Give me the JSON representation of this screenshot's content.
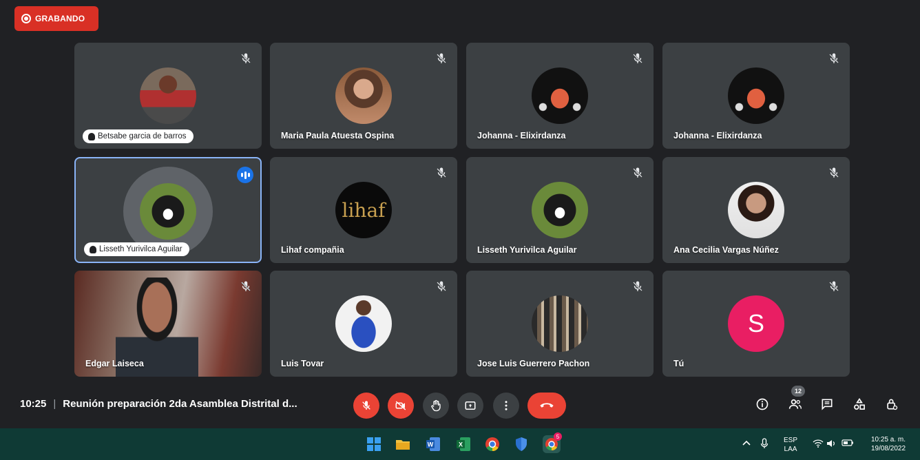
{
  "recording": {
    "label": "GRABANDO"
  },
  "participants": [
    {
      "name": "Betsabe garcia de barros"
    },
    {
      "name": "Maria Paula Atuesta Ospina"
    },
    {
      "name": "Johanna - Elixirdanza"
    },
    {
      "name": "Johanna - Elixirdanza"
    },
    {
      "name": "Lisseth Yurivilca Aguilar"
    },
    {
      "name": "Lihaf compañia"
    },
    {
      "name": "Lisseth Yurivilca Aguilar"
    },
    {
      "name": "Ana Cecilia Vargas Núñez"
    },
    {
      "name": "Edgar Laiseca"
    },
    {
      "name": "Luis Tovar"
    },
    {
      "name": "Jose Luis Guerrero Pachon"
    },
    {
      "name": "Tú",
      "initial": "S"
    }
  ],
  "meeting": {
    "time": "10:25",
    "separator": "|",
    "title": "Reunión preparación 2da Asamblea Distrital d..."
  },
  "people_count": "12",
  "taskbar": {
    "lang": "ESP",
    "lang_sub": "LAA",
    "clock_time": "10:25 a. m.",
    "clock_date": "19/08/2022",
    "chrome_badge": "5"
  },
  "colors": {
    "background": "#202124",
    "tile": "#3c4043",
    "recording": "#d93025",
    "danger": "#ea4335",
    "active_border": "#8ab4f8",
    "taskbar": "#0f3a35"
  },
  "icons": [
    "record-icon",
    "mic-off-icon",
    "camera-off-icon",
    "hand-icon",
    "present-icon",
    "more-icon",
    "hangup-icon",
    "info-icon",
    "people-icon",
    "chat-icon",
    "activities-icon",
    "host-controls-icon",
    "speaking-icon"
  ]
}
